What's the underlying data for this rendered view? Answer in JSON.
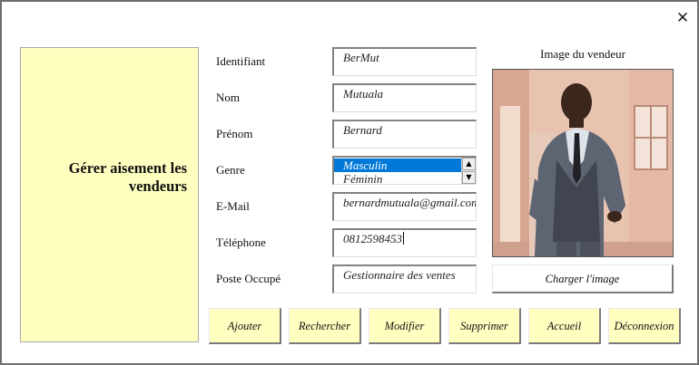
{
  "window": {
    "close_icon": "close-icon"
  },
  "panel": {
    "title": "Gérer aisement les vendeurs",
    "color": "#ffffc0"
  },
  "form": {
    "identifiant": {
      "label": "Identifiant",
      "value": "BerMut"
    },
    "nom": {
      "label": "Nom",
      "value": "Mutuala"
    },
    "prenom": {
      "label": "Prénom",
      "value": "Bernard"
    },
    "genre": {
      "label": "Genre",
      "options": [
        "Masculin",
        "Féminin"
      ],
      "selected": "Masculin"
    },
    "email": {
      "label": "E-Mail",
      "value": "bernardmutuala@gmail.com"
    },
    "telephone": {
      "label": "Téléphone",
      "value": "0812598453"
    },
    "poste": {
      "label": "Poste Occupé",
      "value": "Gestionnaire des ventes"
    }
  },
  "image": {
    "title": "Image du vendeur",
    "load_label": "Charger l'image"
  },
  "actions": {
    "ajouter": "Ajouter",
    "rechercher": "Rechercher",
    "modifier": "Modifier",
    "supprimer": "Supprimer",
    "accueil": "Accueil",
    "deconnexion": "Déconnexion"
  },
  "colors": {
    "accent_selected": "#0078d7",
    "button_yellow": "#ffffc0"
  }
}
